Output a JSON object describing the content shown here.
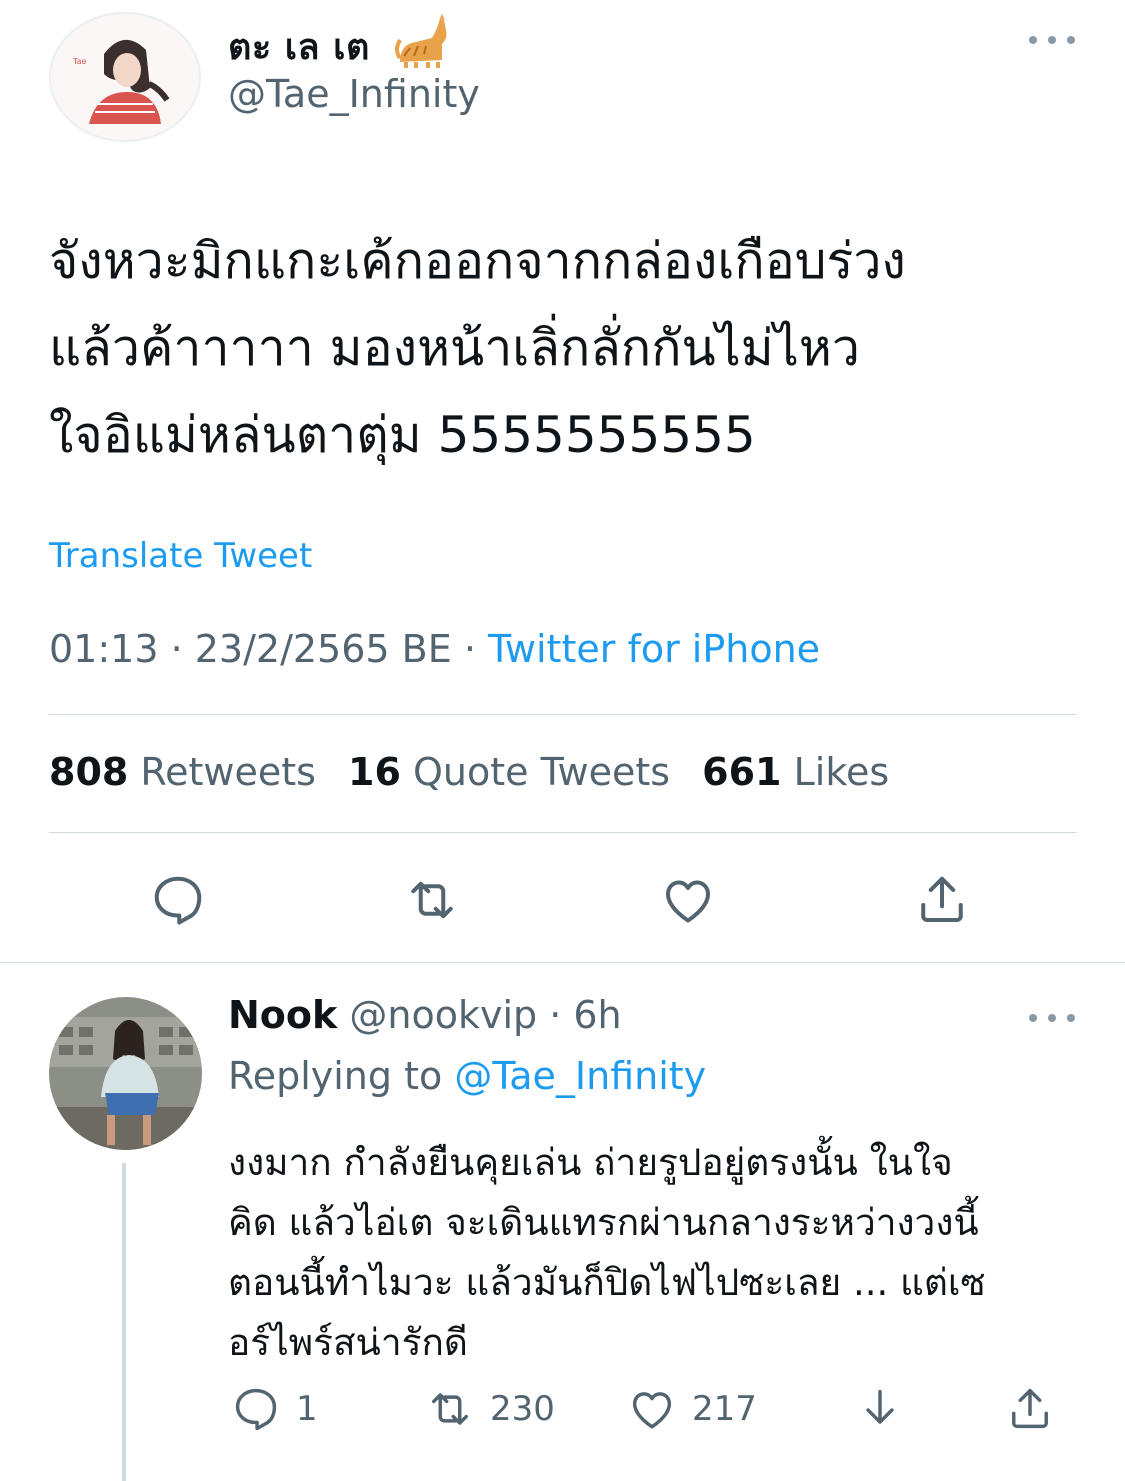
{
  "tweet": {
    "author_name": "ตะ เล เต",
    "author_handle": "@Tae_Infinity",
    "text_lines": [
      "จังหวะมิกแกะเค้กออกจากกล่องเกือบร่วง",
      "แล้วค้าาาาา มองหน้าเลิ่กลั่กกันไม่ไหว",
      "ใจอิแม่หล่นตาตุ่ม 5555555555"
    ],
    "translate_label": "Translate Tweet",
    "timestamp": "01:13 · 23/2/2565 BE · ",
    "source": "Twitter for iPhone",
    "stats": {
      "retweets_count": "808",
      "retweets_label": "Retweets",
      "quotes_count": "16",
      "quotes_label": "Quote Tweets",
      "likes_count": "661",
      "likes_label": "Likes"
    }
  },
  "reply": {
    "name": "Nook",
    "handle_time": " @nookvip · 6h",
    "replying_prefix": "Replying to ",
    "replying_handle": "@Tae_Infinity",
    "text_lines": [
      "งงมาก กำลังยืนคุยเล่น ถ่ายรูปอยู่ตรงนั้น ในใจ",
      "คิด แล้วไอ่เต จะเดินแทรกผ่านกลางระหว่างวงนี้",
      "ตอนนี้ทำไมวะ แล้วมันก็ปิดไฟไปซะเลย ... แต่เซ",
      "อร์ไพร์สน่ารักดี"
    ],
    "reply_count": "1",
    "retweet_count": "230",
    "like_count": "217"
  },
  "colors": {
    "accent": "#1d9bf0",
    "secondary_text": "#536471",
    "primary_text": "#0f1419",
    "divider": "#cfd9de"
  },
  "icons": [
    "more-icon",
    "reply-icon",
    "retweet-icon",
    "like-icon",
    "share-icon",
    "download-icon",
    "cat-emoji-icon"
  ]
}
